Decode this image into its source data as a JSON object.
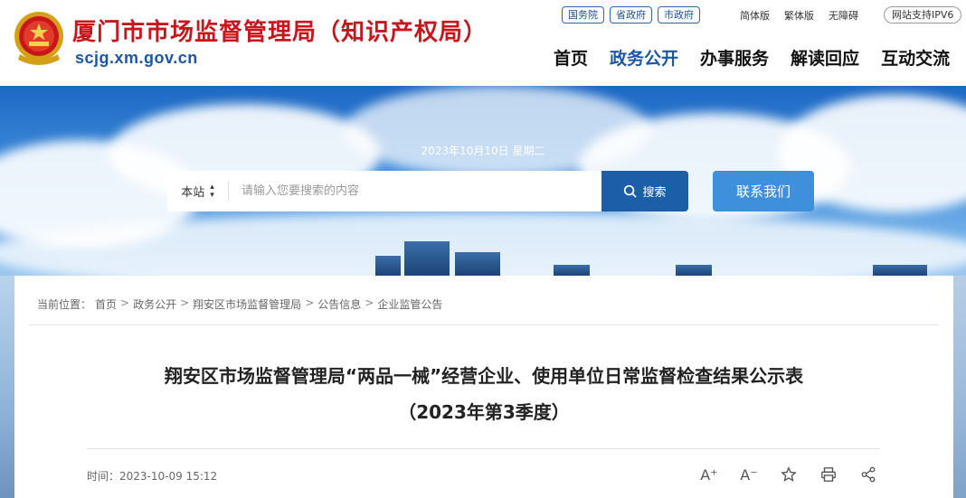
{
  "header": {
    "site_title": "厦门市市场监督管理局（知识产权局）",
    "site_domain": "scjg.xm.gov.cn",
    "top_links": [
      "国务院",
      "省政府",
      "市政府"
    ],
    "util_links": [
      "简体版",
      "繁体版",
      "无障碍"
    ],
    "ipv6": "网站支持IPV6",
    "nav": [
      "首页",
      "政务公开",
      "办事服务",
      "解读回应",
      "互动交流"
    ],
    "active_nav": "政务公开"
  },
  "banner": {
    "date": "2023年10月10日 星期二",
    "search_scope": "本站",
    "search_placeholder": "请输入您要搜索的内容",
    "search_button": "搜索",
    "contact_button": "联系我们"
  },
  "breadcrumb": {
    "label": "当前位置：",
    "items": [
      "首页",
      "政务公开",
      "翔安区市场监督管理局",
      "公告信息",
      "企业监管公告"
    ],
    "separator": ">"
  },
  "article": {
    "title": "翔安区市场监督管理局“两品一械”经营企业、使用单位日常监督检查结果公示表",
    "subtitle": "（2023年第3季度）",
    "time_label": "时间：",
    "time_value": "2023-10-09 15:12"
  },
  "tools": {
    "increase_font": "A⁺",
    "decrease_font": "A⁻"
  },
  "colors": {
    "brand_red": "#c8161d",
    "brand_blue": "#1c56a6",
    "search_button": "#1c5fa8",
    "contact_button": "#3e90dc"
  }
}
